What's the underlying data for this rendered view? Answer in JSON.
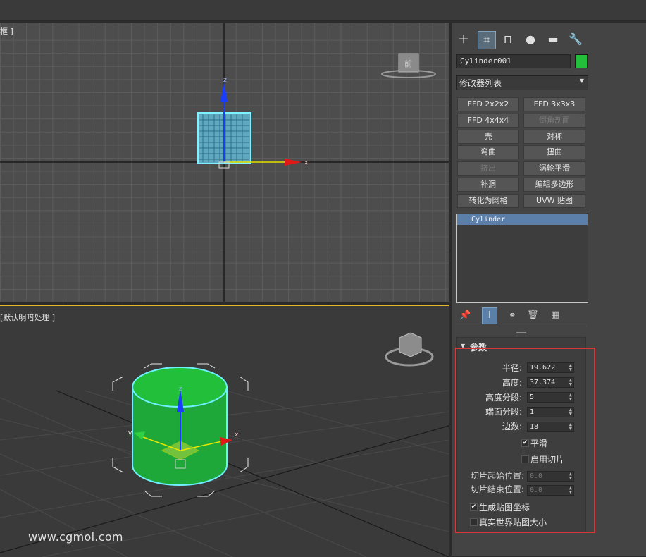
{
  "viewports": {
    "top_label": "框 ]",
    "persp_label": "[默认明暗处理 ]",
    "top_view_cube_label": "前",
    "axis_x": "x",
    "axis_y": "y",
    "axis_z": "z"
  },
  "panel": {
    "tabs": [
      {
        "icon": "plus-icon",
        "active": false
      },
      {
        "icon": "modify-icon",
        "active": true
      },
      {
        "icon": "hierarchy-icon",
        "active": false
      },
      {
        "icon": "motion-icon",
        "active": false
      },
      {
        "icon": "display-icon",
        "active": false
      },
      {
        "icon": "utilities-icon",
        "active": false
      }
    ],
    "object_name": "Cylinder001",
    "object_color": "#22c03a",
    "modifier_list": "修改器列表",
    "modifier_buttons": [
      {
        "label": "FFD 2x2x2",
        "enabled": true
      },
      {
        "label": "FFD 3x3x3",
        "enabled": true
      },
      {
        "label": "FFD 4x4x4",
        "enabled": true
      },
      {
        "label": "倒角剖面",
        "enabled": false
      },
      {
        "label": "壳",
        "enabled": true
      },
      {
        "label": "对称",
        "enabled": true
      },
      {
        "label": "弯曲",
        "enabled": true
      },
      {
        "label": "扭曲",
        "enabled": true
      },
      {
        "label": "挤出",
        "enabled": false
      },
      {
        "label": "涡轮平滑",
        "enabled": true
      },
      {
        "label": "补洞",
        "enabled": true
      },
      {
        "label": "编辑多边形",
        "enabled": true
      },
      {
        "label": "转化为网格",
        "enabled": true
      },
      {
        "label": "UVW 贴图",
        "enabled": true
      }
    ],
    "stack": [
      "Cylinder"
    ],
    "params": {
      "title": "参数",
      "radius_label": "半径:",
      "radius": "19.622",
      "height_label": "高度:",
      "height": "37.374",
      "height_segs_label": "高度分段:",
      "height_segs": "5",
      "cap_segs_label": "端面分段:",
      "cap_segs": "1",
      "sides_label": "边数:",
      "sides": "18",
      "smooth_label": "平滑",
      "smooth": true,
      "slice_on_label": "启用切片",
      "slice_on": false,
      "slice_from_label": "切片起始位置:",
      "slice_from": "0.0",
      "slice_to_label": "切片结束位置:",
      "slice_to": "0.0",
      "gen_map_label": "生成贴图坐标",
      "gen_map": true,
      "real_world_label": "真实世界贴图大小",
      "real_world": false
    }
  },
  "watermark": "www.cgmol.com"
}
